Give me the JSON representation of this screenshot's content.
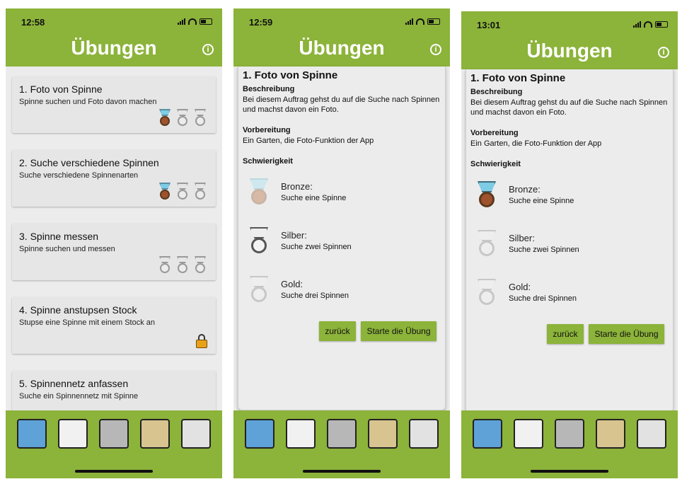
{
  "screens": [
    {
      "time": "12:58",
      "title": "Übungen",
      "info": "i",
      "exercises": [
        {
          "title": "1. Foto von Spinne",
          "subtitle": "Spinne suchen und Foto davon machen"
        },
        {
          "title": "2. Suche verschiedene Spinnen",
          "subtitle": "Suche verschiedene Spinnenarten"
        },
        {
          "title": "3. Spinne messen",
          "subtitle": "Spinne suchen und messen"
        },
        {
          "title": "4. Spinne anstupsen Stock",
          "subtitle": "Stupse eine Spinne mit einem Stock an"
        },
        {
          "title": "5. Spinnennetz anfassen",
          "subtitle": "Suche ein Spinnennetz mit Spinne"
        }
      ]
    },
    {
      "time": "12:59",
      "title": "Übungen",
      "info": "i",
      "detail": {
        "heading": "1. Foto von Spinne",
        "desc_label": "Beschreibung",
        "desc_text": "Bei diesem Auftrag gehst du auf die Suche nach Spinnen und machst davon ein Foto.",
        "prep_label": "Vorbereitung",
        "prep_text": "Ein Garten, die Foto-Funktion der App",
        "difficulty_label": "Schwierigkeit",
        "levels": [
          {
            "name": "Bronze:",
            "task": "Suche eine Spinne"
          },
          {
            "name": "Silber:",
            "task": "Suche zwei Spinnen"
          },
          {
            "name": "Gold:",
            "task": "Suche drei Spinnen"
          }
        ],
        "back": "zurück",
        "start": "Starte die Übung"
      }
    },
    {
      "time": "13:01",
      "title": "Übungen",
      "info": "i",
      "detail": {
        "heading": "1. Foto von Spinne",
        "desc_label": "Beschreibung",
        "desc_text": "Bei diesem Auftrag gehst du auf die Suche nach Spinnen und machst davon ein Foto.",
        "prep_label": "Vorbereitung",
        "prep_text": "Ein Garten, die Foto-Funktion der App",
        "difficulty_label": "Schwierigkeit",
        "levels": [
          {
            "name": "Bronze:",
            "task": "Suche eine Spinne"
          },
          {
            "name": "Silber:",
            "task": "Suche zwei Spinnen"
          },
          {
            "name": "Gold:",
            "task": "Suche drei Spinnen"
          }
        ],
        "back": "zurück",
        "start": "Starte die Übung"
      }
    }
  ],
  "colors": {
    "accent": "#8cb33a",
    "background": "#ececec"
  },
  "nav_icons": [
    "teacher-desk-icon",
    "checklist-icon",
    "camera-icon",
    "framed-picture-icon",
    "market-stall-icon"
  ]
}
